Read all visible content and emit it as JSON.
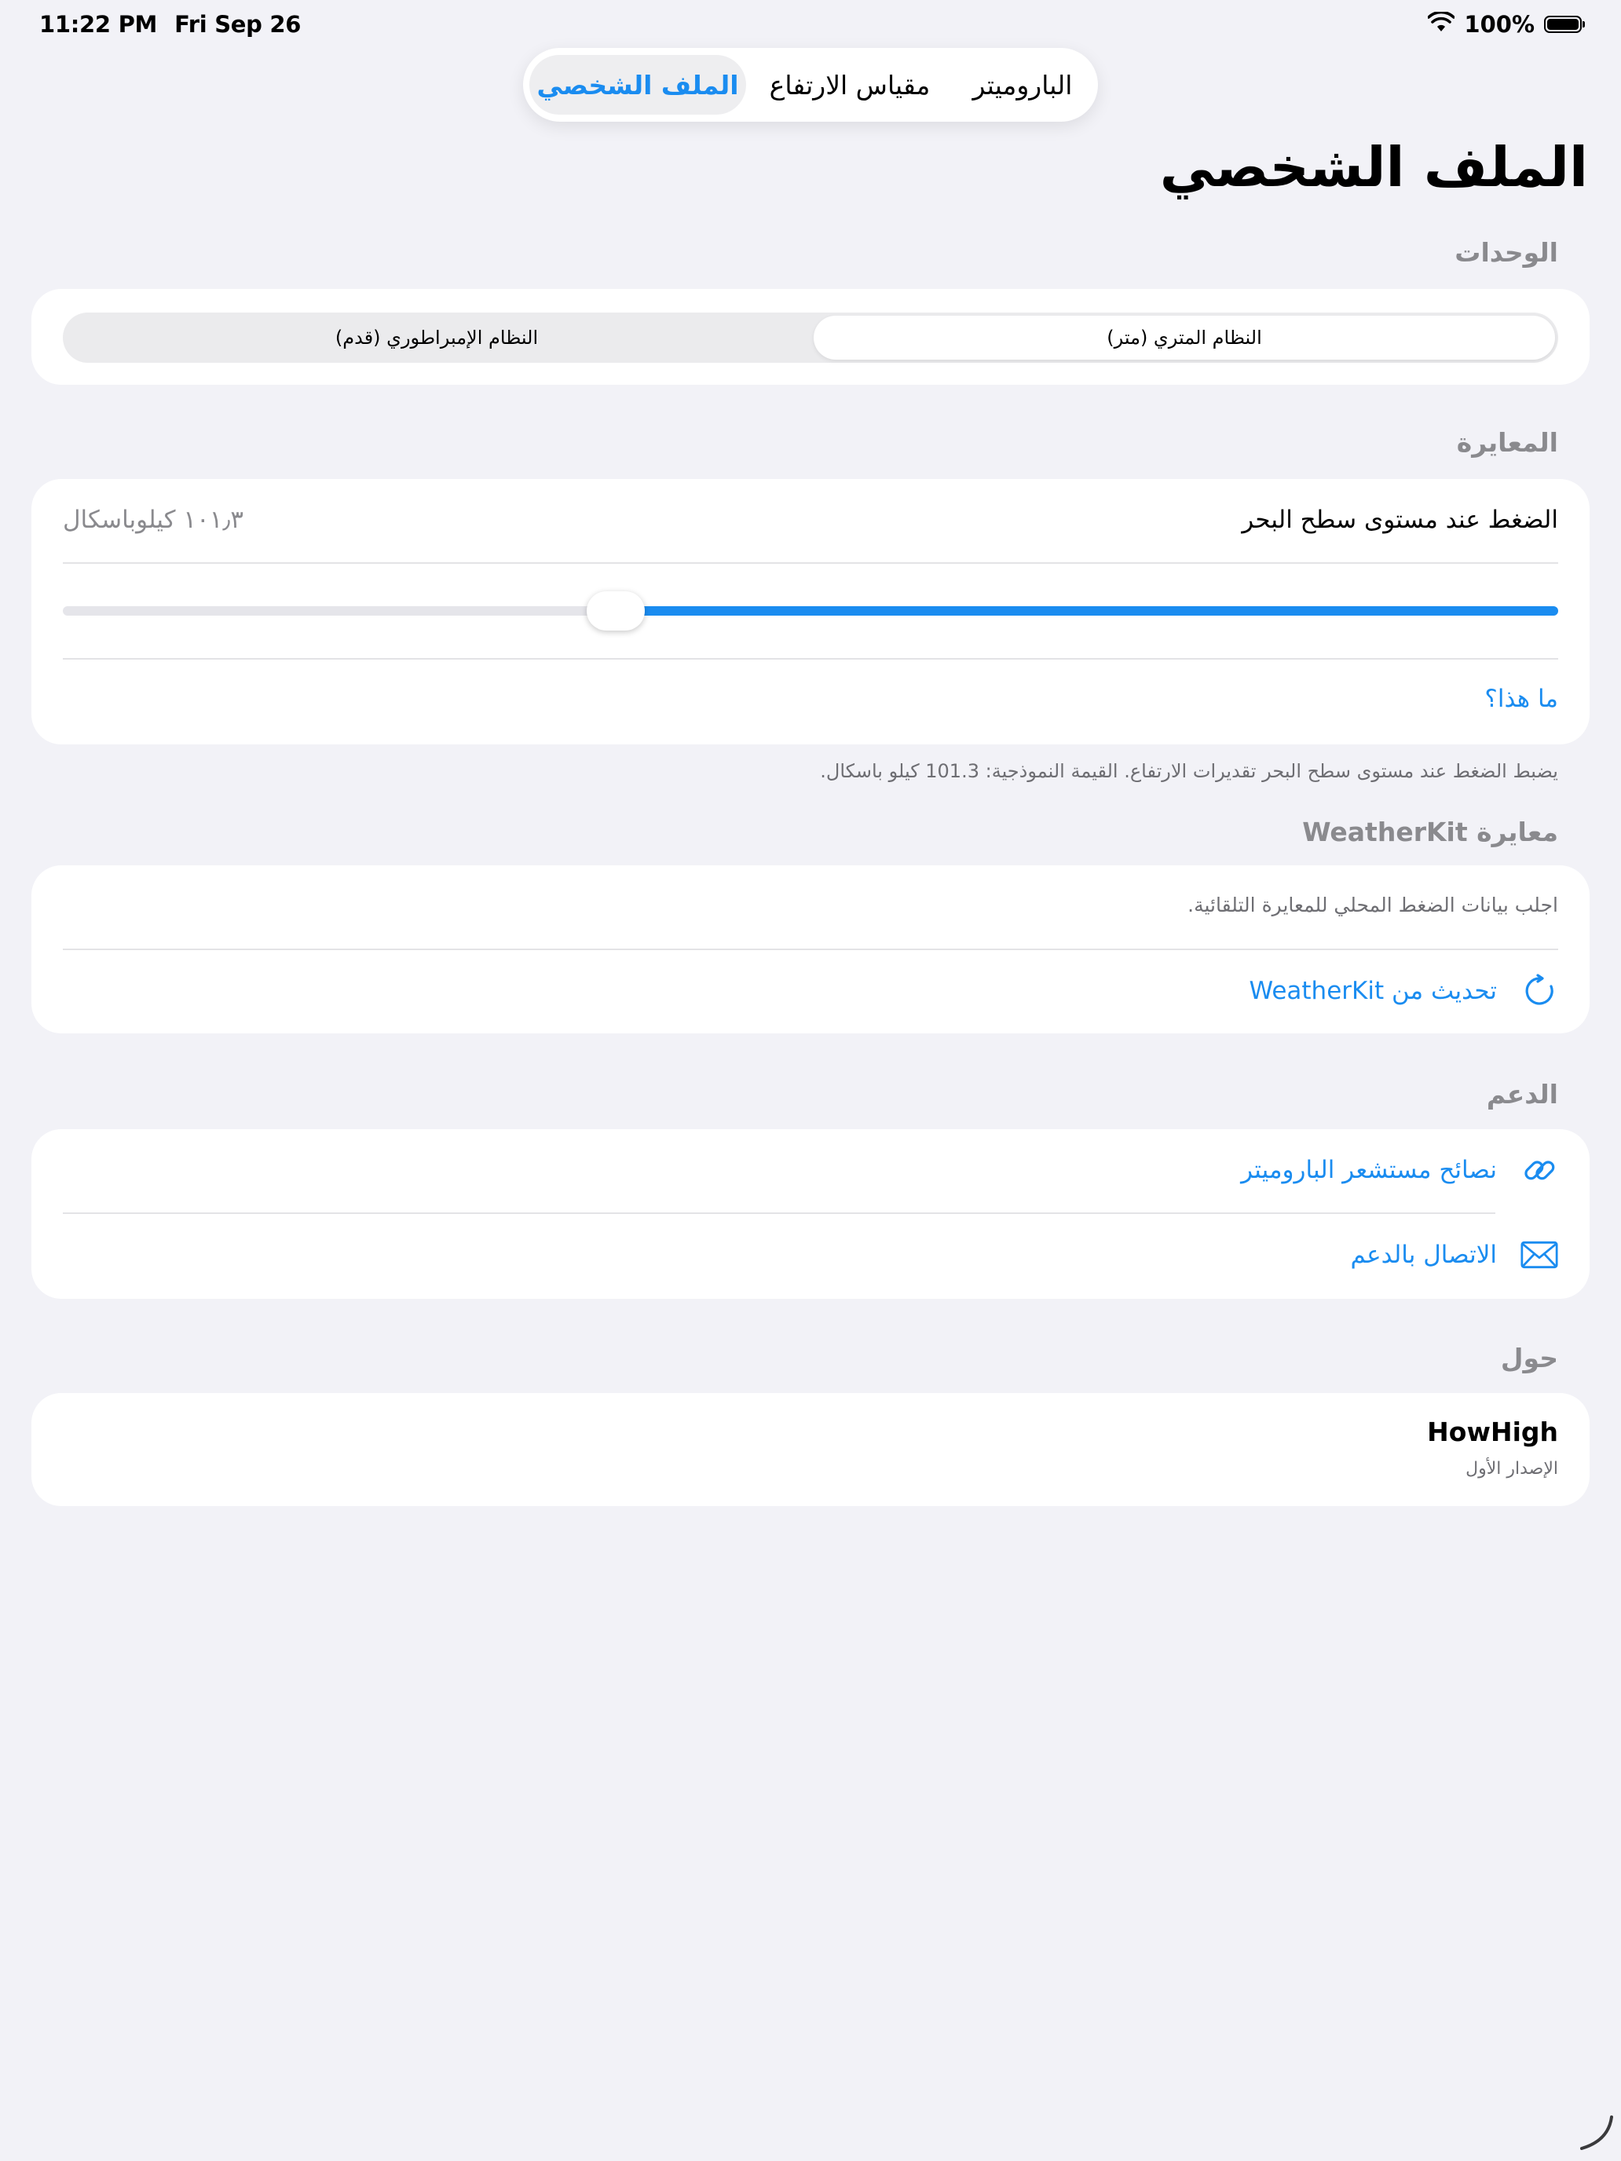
{
  "status_bar": {
    "time": "11:22 PM",
    "date": "Fri Sep 26",
    "battery_text": "100%"
  },
  "tabs": [
    {
      "label": "الباروميتر"
    },
    {
      "label": "مقياس الارتفاع"
    },
    {
      "label": "الملف الشخصي",
      "active": true
    }
  ],
  "page": {
    "title": "الملف الشخصي"
  },
  "units": {
    "header": "الوحدات",
    "options": [
      {
        "label": "النظام المتري (متر)",
        "selected": true
      },
      {
        "label": "النظام الإمبراطوري (قدم)",
        "selected": false
      }
    ]
  },
  "calibration": {
    "header": "المعايرة",
    "label": "الضغط عند مستوى سطح البحر",
    "value": "١٠١٫٣ كيلوباسكال",
    "slider_fraction": 0.63,
    "help_link": "ما هذا؟",
    "footnote": "يضبط الضغط عند مستوى سطح البحر تقديرات الارتفاع. القيمة النموذجية: 101.3 كيلو باسكال."
  },
  "weatherkit": {
    "header": "معايرة WeatherKit",
    "description": "اجلب بيانات الضغط المحلي للمعايرة التلقائية.",
    "update_label": "تحديث من WeatherKit",
    "update_icon": "refresh-icon"
  },
  "support": {
    "header": "الدعم",
    "items": [
      {
        "label": "نصائح مستشعر الباروميتر",
        "icon": "link-icon"
      },
      {
        "label": "الاتصال بالدعم",
        "icon": "envelope-icon"
      }
    ]
  },
  "about": {
    "header": "حول",
    "app_name": "HowHigh",
    "version": "الإصدار الأول"
  },
  "colors": {
    "accent": "#1a8cf0",
    "background": "#f2f2f7",
    "card": "#ffffff",
    "secondary_text": "#8a8a8e"
  }
}
